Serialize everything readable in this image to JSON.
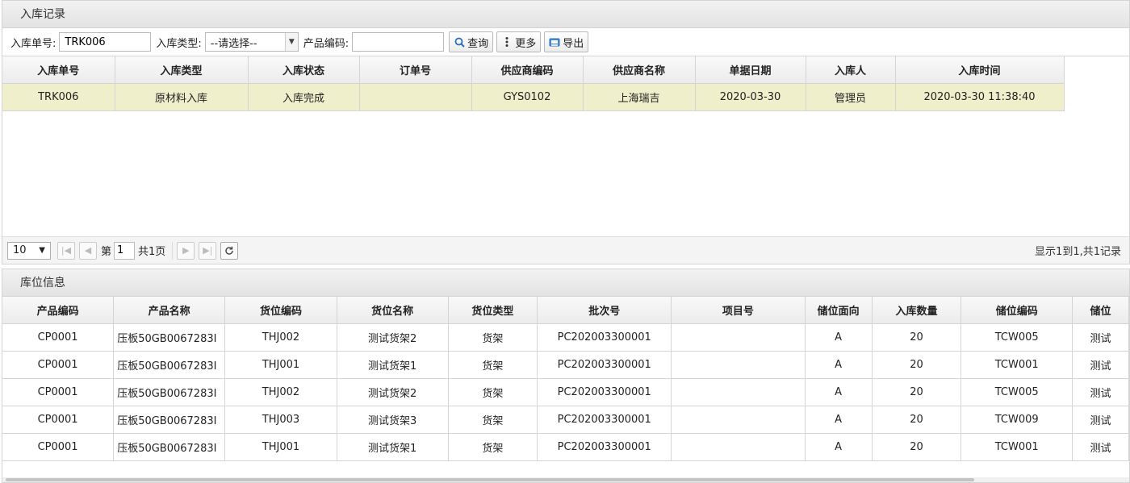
{
  "receipt_panel": {
    "title": "入库记录",
    "filters": {
      "order_no_label": "入库单号:",
      "order_no_value": "TRK006",
      "type_label": "入库类型:",
      "type_value": "--请选择--",
      "product_code_label": "产品编码:",
      "product_code_value": ""
    },
    "buttons": {
      "query": "查询",
      "more": "更多",
      "export": "导出"
    },
    "columns": [
      "入库单号",
      "入库类型",
      "入库状态",
      "订单号",
      "供应商编码",
      "供应商名称",
      "单据日期",
      "入库人",
      "入库时间"
    ],
    "rows": [
      [
        "TRK006",
        "原材料入库",
        "入库完成",
        "",
        "GYS0102",
        "上海瑞吉",
        "2020-03-30",
        "管理员",
        "2020-03-30 11:38:40"
      ]
    ],
    "pager": {
      "page_size": "10",
      "page_prefix": "第",
      "page_value": "1",
      "page_total": "共1页",
      "info": "显示1到1,共1记录"
    }
  },
  "location_panel": {
    "title": "库位信息",
    "columns": [
      "产品编码",
      "产品名称",
      "货位编码",
      "货位名称",
      "货位类型",
      "批次号",
      "项目号",
      "储位面向",
      "入库数量",
      "储位编码",
      "储位"
    ],
    "rows": [
      [
        "CP0001",
        "压板50GB0067283I",
        "THJ002",
        "测试货架2",
        "货架",
        "PC202003300001",
        "",
        "A",
        "20",
        "TCW005",
        "测试"
      ],
      [
        "CP0001",
        "压板50GB0067283I",
        "THJ001",
        "测试货架1",
        "货架",
        "PC202003300001",
        "",
        "A",
        "20",
        "TCW001",
        "测试"
      ],
      [
        "CP0001",
        "压板50GB0067283I",
        "THJ002",
        "测试货架2",
        "货架",
        "PC202003300001",
        "",
        "A",
        "20",
        "TCW005",
        "测试"
      ],
      [
        "CP0001",
        "压板50GB0067283I",
        "THJ003",
        "测试货架3",
        "货架",
        "PC202003300001",
        "",
        "A",
        "20",
        "TCW009",
        "测试"
      ],
      [
        "CP0001",
        "压板50GB0067283I",
        "THJ001",
        "测试货架1",
        "货架",
        "PC202003300001",
        "",
        "A",
        "20",
        "TCW001",
        "测试"
      ]
    ]
  }
}
